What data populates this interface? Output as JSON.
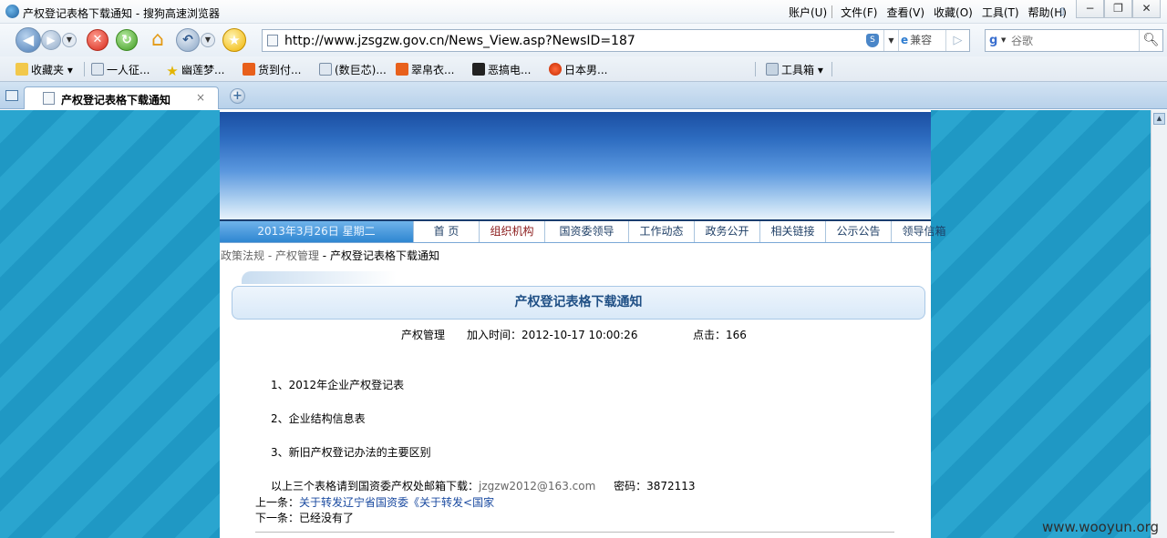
{
  "window": {
    "title": "产权登记表格下载通知 - 搜狗高速浏览器",
    "menu": [
      "账户(U)",
      "文件(F)",
      "查看(V)",
      "收藏(O)",
      "工具(T)",
      "帮助(H)"
    ],
    "buttons": [
      "−",
      "❐",
      "✕"
    ]
  },
  "toolbar": {
    "url": "http://www.jzsgzw.gov.cn/News_View.asp?NewsID=187",
    "compat_label": "兼容",
    "search_placeholder": "谷歌"
  },
  "favorites": {
    "items": [
      {
        "label": "收藏夹",
        "icon": "star-folder-icon"
      },
      {
        "label": "一人征...",
        "icon": "page-icon"
      },
      {
        "label": "幽莲梦...",
        "icon": "star-icon"
      },
      {
        "label": "货到付...",
        "icon": "pai-icon"
      },
      {
        "label": "(数巨芯)...",
        "icon": "page-icon"
      },
      {
        "label": "翠帛衣...",
        "icon": "pai-icon"
      },
      {
        "label": "恶搞电...",
        "icon": "download-icon"
      },
      {
        "label": "日本男...",
        "icon": "pin-icon"
      },
      {
        "label": "工具箱",
        "icon": "toolbox-icon"
      }
    ]
  },
  "tabs": [
    {
      "title": "产权登记表格下载通知",
      "close": "×"
    }
  ],
  "page": {
    "date": "2013年3月26日 星期二",
    "nav": [
      "首 页",
      "组织机构",
      "国资委领导",
      "工作动态",
      "政务公开",
      "相关链接",
      "公示公告",
      "领导信箱"
    ],
    "breadcrumb": {
      "part1": "政策法规",
      "part2": " - 产权管理",
      "current": " - 产权登记表格下载通知"
    },
    "article": {
      "title": "产权登记表格下载通知",
      "category": "产权管理",
      "added_label": "加入时间：2012-10-17 10:00:26",
      "clicks_label": "点击：166",
      "items": [
        "1、2012年企业产权登记表",
        "2、企业结构信息表",
        "3、新旧产权登记办法的主要区别"
      ],
      "note_prefix": "以上三个表格请到国资委产权处邮箱下载：",
      "email": "jzgzw2012@163.com",
      "password_label": "密码：3872113",
      "prev_label": "上一条：",
      "prev_link": "关于转发辽宁省国资委《关于转发<国家",
      "next_label": "下一条：",
      "next_text": "已经没有了"
    }
  },
  "watermark": "www.wooyun.org",
  "colors": {
    "background_stripe_1": "#2aa5cf",
    "background_stripe_2": "#1f98c4",
    "banner_top": "#1b4fa2",
    "title_text": "#1f4f85",
    "link": "#1a4aa0",
    "active_nav": "#8b1a1a"
  }
}
